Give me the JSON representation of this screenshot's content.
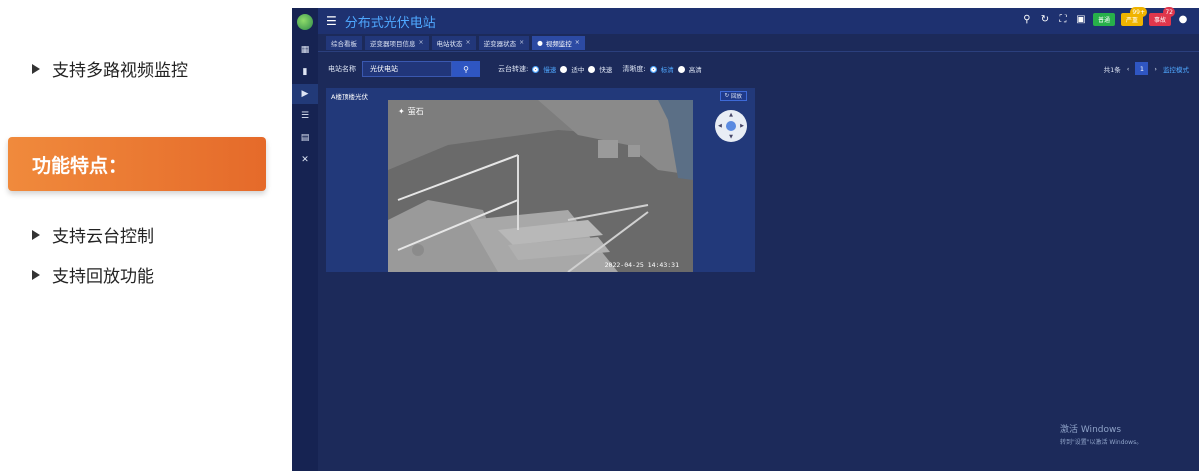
{
  "slide": {
    "bullet1": "支持多路视频监控",
    "feature_heading": "功能特点：",
    "bullet2": "支持云台控制",
    "bullet3": "支持回放功能"
  },
  "app": {
    "title": "分布式光伏电站",
    "topbar": {
      "pills": [
        {
          "label": "普通",
          "color": "#27b04a",
          "badge": ""
        },
        {
          "label": "严重",
          "color": "#f0b400",
          "badge": "99+"
        },
        {
          "label": "事故",
          "color": "#e0364c",
          "badge": "72"
        }
      ]
    },
    "tabs": [
      "综合看板",
      "逆变器项目信息",
      "电站状态",
      "逆变器状态",
      "视频监控"
    ],
    "filters": {
      "station_label": "电站名称",
      "station_value": "光伏电站",
      "ptz_speed_label": "云台转速:",
      "speeds": [
        "慢速",
        "适中",
        "快速"
      ],
      "clarity_label": "清晰度:",
      "clarities": [
        "标清",
        "高清"
      ]
    },
    "pager": {
      "total": "共1条",
      "page": "1",
      "mode_link": "监控模式"
    },
    "camera": {
      "title": "A楼顶楼光伏",
      "replay": "回放",
      "watermark": "萤石",
      "timestamp": "2022-04-25 14:43:31"
    },
    "windows": {
      "line1": "激活 Windows",
      "line2": "转到\"设置\"以激活 Windows。"
    }
  }
}
